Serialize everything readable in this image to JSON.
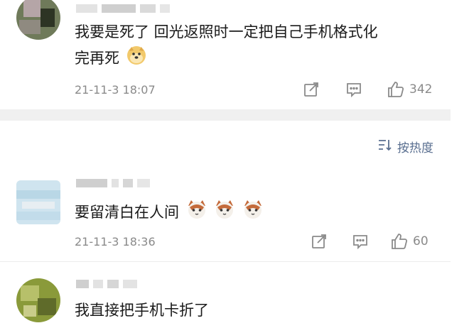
{
  "comments": [
    {
      "text_line1": "我要是死了 回光返照时一定把自己手机格式化",
      "text_line2": "完再死",
      "timestamp": "21-11-3 18:07",
      "likes": "342",
      "avatar_colors": [
        "#6f7a5a",
        "#b5a5a7",
        "#2d3424"
      ],
      "emoji": "doge-emoji"
    },
    {
      "text": "要留清白在人间",
      "timestamp": "21-11-3 18:36",
      "likes": "60",
      "avatar_colors": [
        "#b9d7e6",
        "#e7eef2",
        "#cfe4ef"
      ],
      "emoji": "cat-emoji"
    },
    {
      "text": "我直接把手机卡折了",
      "avatar_colors": [
        "#8a9a3a",
        "#b7c06a",
        "#5f6b2a"
      ]
    }
  ],
  "sort": {
    "label": "按热度",
    "icon": "sort-icon"
  },
  "colors": {
    "accent": "#5a6f90",
    "meta": "#8a8a8a",
    "divider": "#f0f0f0"
  }
}
